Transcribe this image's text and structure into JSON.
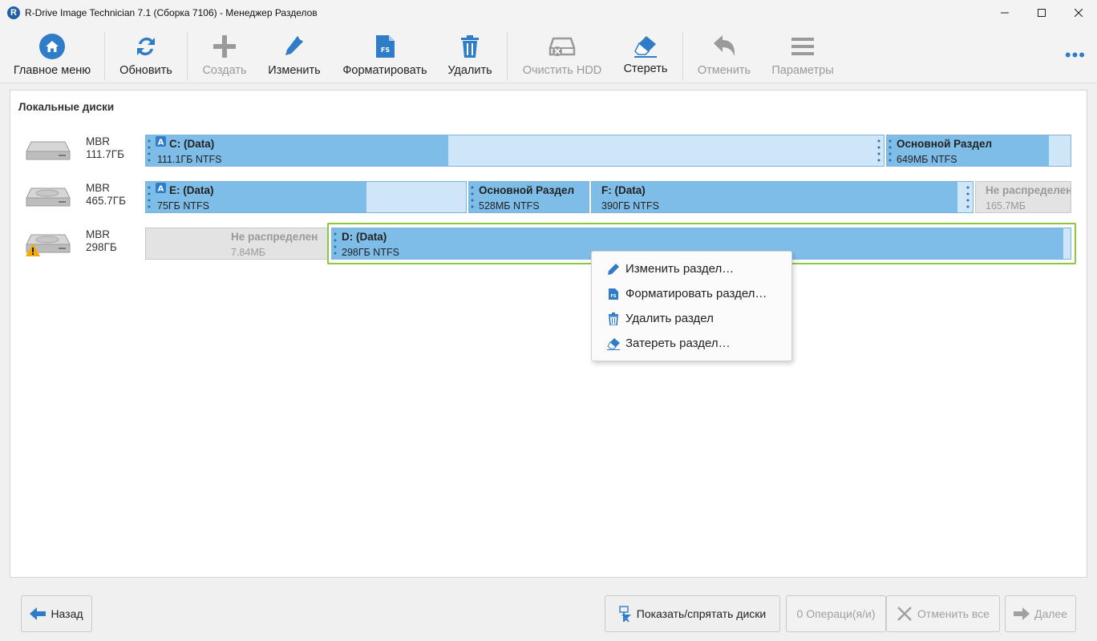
{
  "window": {
    "app_logo": "R",
    "title": "R-Drive Image Technician 7.1 (Сборка 7106) - Менеджер Разделов",
    "minimize_icon": "minimize-icon",
    "maximize_icon": "maximize-icon",
    "close_icon": "close-icon"
  },
  "toolbar": {
    "main_menu": "Главное меню",
    "refresh": "Обновить",
    "create": "Создать",
    "edit": "Изменить",
    "format": "Форматировать",
    "delete": "Удалить",
    "clear_hdd": "Очистить HDD",
    "erase": "Стереть",
    "undo": "Отменить",
    "settings": "Параметры",
    "more": "•••"
  },
  "main": {
    "section_title": "Локальные диски",
    "disks": [
      {
        "type": "MBR",
        "size": "111.7ГБ",
        "partitions": [
          {
            "name": "C: (Data)",
            "size": "111.1ГБ NTFS",
            "used_fraction": 0.41
          },
          {
            "name": "Основной Раздел",
            "size": "649МБ NTFS",
            "used_fraction": 0.88
          }
        ]
      },
      {
        "type": "MBR",
        "size": "465.7ГБ",
        "partitions": [
          {
            "name": "E: (Data)",
            "size": "75ГБ NTFS",
            "used_fraction": 0.69
          },
          {
            "name": "Основной Раздел",
            "size": "528МБ NTFS",
            "used_fraction": 1.0
          },
          {
            "name": "F: (Data)",
            "size": "390ГБ NTFS",
            "used_fraction": 0.96
          },
          {
            "name": "Не распределен",
            "size": "165.7МБ"
          }
        ]
      },
      {
        "type": "MBR",
        "size": "298ГБ",
        "warning": true,
        "partitions": [
          {
            "name": "Не распределен",
            "size": "7.84МБ"
          },
          {
            "name": "D: (Data)",
            "size": "298ГБ NTFS",
            "used_fraction": 0.99
          }
        ]
      }
    ]
  },
  "context_menu": {
    "items": [
      {
        "label": "Изменить раздел…",
        "icon": "pencil-icon"
      },
      {
        "label": "Форматировать раздел…",
        "icon": "format-fs-icon"
      },
      {
        "label": "Удалить раздел",
        "icon": "trash-icon"
      },
      {
        "label": "Затереть раздел…",
        "icon": "eraser-icon"
      }
    ]
  },
  "bottom": {
    "back": "Назад",
    "show_hide_disks": "Показать/спрятать диски",
    "operations": "0 Операци(я/и)",
    "cancel_all": "Отменить все",
    "next": "Далее"
  },
  "colors": {
    "accent": "#2f7dc8",
    "partition_used": "#7fbde9",
    "partition_free": "#cfe6f9",
    "unallocated": "#e3e3e3",
    "selection": "#8cc63f"
  }
}
